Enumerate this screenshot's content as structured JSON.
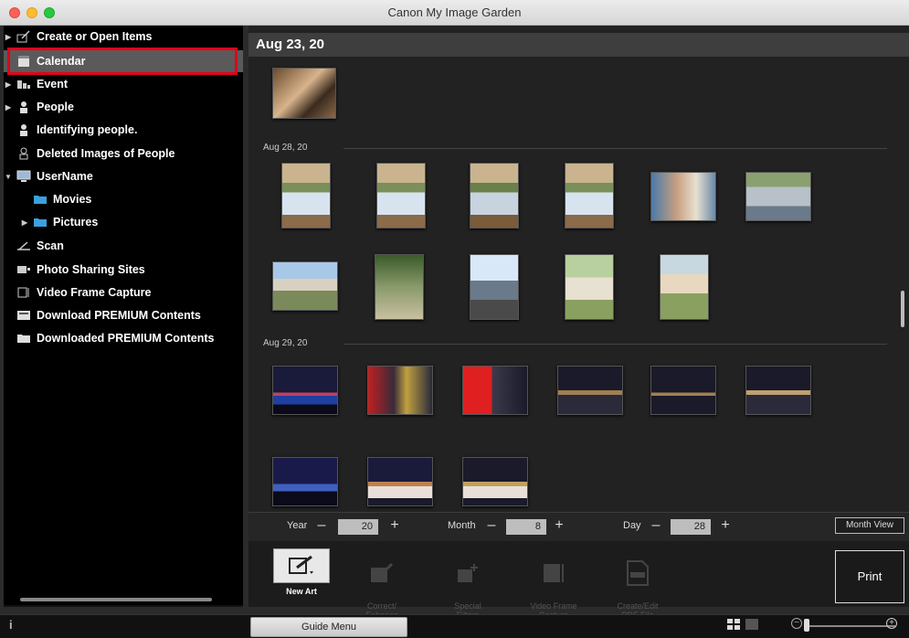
{
  "window": {
    "title": "Canon My Image Garden"
  },
  "sidebar": {
    "items": [
      {
        "label": "Create or Open Items",
        "expander": "▶",
        "icon": "create-items-icon"
      },
      {
        "label": "Calendar",
        "expander": "",
        "icon": "calendar-icon",
        "selected": true
      },
      {
        "label": "Event",
        "expander": "▶",
        "icon": "event-icon"
      },
      {
        "label": "People",
        "expander": "▶",
        "icon": "person-icon"
      },
      {
        "label": "Identifying people.",
        "expander": "",
        "icon": "identifying-person-icon"
      },
      {
        "label": "Deleted Images of People",
        "expander": "",
        "icon": "deleted-person-icon"
      },
      {
        "label": "UserName",
        "expander": "▼",
        "icon": "computer-icon"
      },
      {
        "label": "Movies",
        "expander": "",
        "icon": "folder-icon"
      },
      {
        "label": "Pictures",
        "expander": "▶",
        "icon": "folder-icon"
      },
      {
        "label": "Scan",
        "expander": "",
        "icon": "scan-icon"
      },
      {
        "label": "Photo Sharing Sites",
        "expander": "",
        "icon": "photo-sharing-icon"
      },
      {
        "label": "Video Frame Capture",
        "expander": "",
        "icon": "video-frame-icon"
      },
      {
        "label": "Download PREMIUM Contents",
        "expander": "",
        "icon": "download-premium-icon"
      },
      {
        "label": "Downloaded PREMIUM Contents",
        "expander": "",
        "icon": "downloaded-premium-icon"
      }
    ]
  },
  "main": {
    "header_date": "Aug 23, 20",
    "groups": [
      {
        "label": "Aug 28, 20"
      },
      {
        "label": "Aug 29, 20"
      }
    ]
  },
  "controls": {
    "year_label": "Year",
    "year_value": "20",
    "month_label": "Month",
    "month_value": "8",
    "day_label": "Day",
    "day_value": "28",
    "minus": "–",
    "plus": "+",
    "month_view": "Month View"
  },
  "tools": [
    {
      "label": "New Art",
      "active": true
    },
    {
      "label": "Correct/\nEnhance",
      "active": false
    },
    {
      "label": "Special\nFilters",
      "active": false
    },
    {
      "label": "Video Frame\nCapture",
      "active": false
    },
    {
      "label": "Create/Edit\nPDF File",
      "active": false
    }
  ],
  "print_label": "Print",
  "bottom": {
    "guide_menu": "Guide Menu",
    "info": "i"
  },
  "colors": {
    "selection_highlight": "#e3001b",
    "sidebar_bg": "#000000",
    "main_bg": "#222222"
  }
}
